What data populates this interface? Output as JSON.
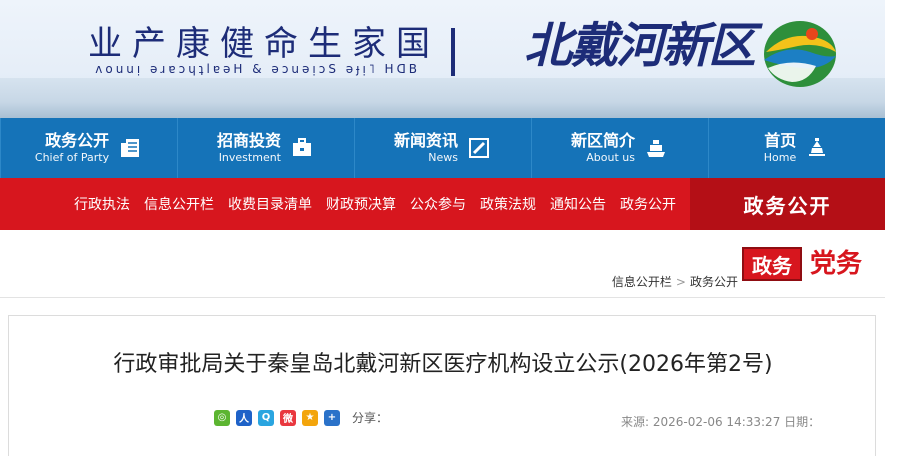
{
  "header": {
    "title_cn": "业产康健命生家国",
    "title_en": "ʌouuᴉ ǝɹɐɔɥʇlɐǝH & ǝɔuǝᴉɔS ǝɟᴉ˥ HᗡB",
    "brand": "北戴河新区"
  },
  "nav": {
    "items": [
      {
        "cn": "首页",
        "en": "Home",
        "icon": "home-icon"
      },
      {
        "cn": "新区简介",
        "en": "About us",
        "icon": "ship-icon"
      },
      {
        "cn": "新闻资讯",
        "en": "News",
        "icon": "news-icon"
      },
      {
        "cn": "招商投资",
        "en": "Investment",
        "icon": "briefcase-icon"
      },
      {
        "cn": "政务公开",
        "en": "Chief of Party",
        "icon": "document-icon"
      }
    ]
  },
  "redbar": {
    "title": "政务公开",
    "links": [
      "政务公开",
      "通知公告",
      "政策法规",
      "公众参与",
      "财政预决算",
      "收费目录清单",
      "信息公开栏",
      "行政执法"
    ]
  },
  "section": {
    "badge_gov": "政务",
    "badge_party": "党务"
  },
  "breadcrumb": {
    "items": [
      "政务公开",
      "信息公开栏"
    ],
    "separator": ">"
  },
  "article": {
    "title": "行政审批局关于秦皇岛北戴河新区医疗机构设立公示(2026年第2号)",
    "date_label": "日期：",
    "date": "2026-02-06 14:33:27",
    "source_label": "来源:",
    "share_label": "分享："
  },
  "colors": {
    "nav_blue": "#1573b8",
    "red": "#d7161e",
    "brand_navy": "#1d2c78"
  }
}
